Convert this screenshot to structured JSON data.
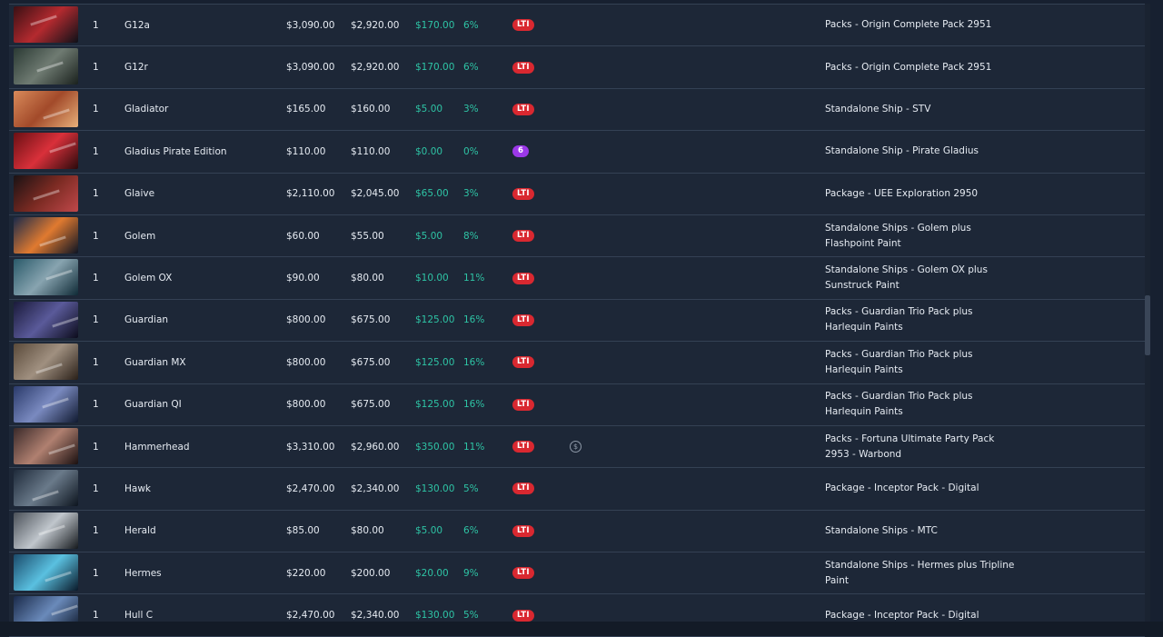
{
  "rows": [
    {
      "qty": "1",
      "name": "G12a",
      "original": "$3,090.00",
      "current": "$2,920.00",
      "savings": "$170.00",
      "percent": "6%",
      "insurance": "LTI",
      "insurance_type": "lti",
      "flag": "",
      "source": "Packs - Origin Complete Pack 2951",
      "thumb": [
        "#3a1014",
        "#b42a2f",
        "#0d1118"
      ]
    },
    {
      "qty": "1",
      "name": "G12r",
      "original": "$3,090.00",
      "current": "$2,920.00",
      "savings": "$170.00",
      "percent": "6%",
      "insurance": "LTI",
      "insurance_type": "lti",
      "flag": "",
      "source": "Packs - Origin Complete Pack 2951",
      "thumb": [
        "#2b3a34",
        "#6f7b72",
        "#1a211d"
      ]
    },
    {
      "qty": "1",
      "name": "Gladiator",
      "original": "$165.00",
      "current": "$160.00",
      "savings": "$5.00",
      "percent": "3%",
      "insurance": "LTI",
      "insurance_type": "lti",
      "flag": "",
      "source": "Standalone Ship - STV",
      "thumb": [
        "#d98a5a",
        "#a24a2a",
        "#e8b07a"
      ]
    },
    {
      "qty": "1",
      "name": "Gladius Pirate Edition",
      "original": "$110.00",
      "current": "$110.00",
      "savings": "$0.00",
      "percent": "0%",
      "insurance": "6",
      "insurance_type": "num",
      "flag": "",
      "source": "Standalone Ship - Pirate Gladius",
      "thumb": [
        "#6a1014",
        "#d9303a",
        "#2a0a0c"
      ]
    },
    {
      "qty": "1",
      "name": "Glaive",
      "original": "$2,110.00",
      "current": "$2,045.00",
      "savings": "$65.00",
      "percent": "3%",
      "insurance": "LTI",
      "insurance_type": "lti",
      "flag": "",
      "source": "Package - UEE Exploration 2950",
      "thumb": [
        "#1a1214",
        "#7a2a22",
        "#c0484a"
      ]
    },
    {
      "qty": "1",
      "name": "Golem",
      "original": "$60.00",
      "current": "$55.00",
      "savings": "$5.00",
      "percent": "8%",
      "insurance": "LTI",
      "insurance_type": "lti",
      "flag": "",
      "source": "Standalone Ships - Golem plus Flashpoint Paint",
      "thumb": [
        "#1a2a4a",
        "#e07a30",
        "#0c1424"
      ]
    },
    {
      "qty": "1",
      "name": "Golem OX",
      "original": "$90.00",
      "current": "$80.00",
      "savings": "$10.00",
      "percent": "11%",
      "insurance": "LTI",
      "insurance_type": "lti",
      "flag": "",
      "source": "Standalone Ships - Golem OX plus Sunstruck Paint",
      "thumb": [
        "#2a5a6a",
        "#88a4b0",
        "#0f2a36"
      ]
    },
    {
      "qty": "1",
      "name": "Guardian",
      "original": "$800.00",
      "current": "$675.00",
      "savings": "$125.00",
      "percent": "16%",
      "insurance": "LTI",
      "insurance_type": "lti",
      "flag": "",
      "source": "Packs - Guardian Trio Pack plus Harlequin Paints",
      "thumb": [
        "#1a1a3a",
        "#5a5a9a",
        "#0c0c1c"
      ]
    },
    {
      "qty": "1",
      "name": "Guardian MX",
      "original": "$800.00",
      "current": "$675.00",
      "savings": "$125.00",
      "percent": "16%",
      "insurance": "LTI",
      "insurance_type": "lti",
      "flag": "",
      "source": "Packs - Guardian Trio Pack plus Harlequin Paints",
      "thumb": [
        "#5a4a3a",
        "#a09080",
        "#2a2018"
      ]
    },
    {
      "qty": "1",
      "name": "Guardian QI",
      "original": "$800.00",
      "current": "$675.00",
      "savings": "$125.00",
      "percent": "16%",
      "insurance": "LTI",
      "insurance_type": "lti",
      "flag": "",
      "source": "Packs - Guardian Trio Pack plus Harlequin Paints",
      "thumb": [
        "#2a3a6a",
        "#7a8ac0",
        "#101a30"
      ]
    },
    {
      "qty": "1",
      "name": "Hammerhead",
      "original": "$3,310.00",
      "current": "$2,960.00",
      "savings": "$350.00",
      "percent": "11%",
      "insurance": "LTI",
      "insurance_type": "lti",
      "flag": "$",
      "source": "Packs - Fortuna Ultimate Party Pack 2953 - Warbond",
      "thumb": [
        "#3a2a2a",
        "#b08070",
        "#1a1010"
      ]
    },
    {
      "qty": "1",
      "name": "Hawk",
      "original": "$2,470.00",
      "current": "$2,340.00",
      "savings": "$130.00",
      "percent": "5%",
      "insurance": "LTI",
      "insurance_type": "lti",
      "flag": "",
      "source": "Package - Inceptor Pack - Digital",
      "thumb": [
        "#1e2a3a",
        "#6a7a8a",
        "#0c141e"
      ]
    },
    {
      "qty": "1",
      "name": "Herald",
      "original": "$85.00",
      "current": "$80.00",
      "savings": "$5.00",
      "percent": "6%",
      "insurance": "LTI",
      "insurance_type": "lti",
      "flag": "",
      "source": "Standalone Ships - MTC",
      "thumb": [
        "#4a5058",
        "#c0c6cc",
        "#14181c"
      ]
    },
    {
      "qty": "1",
      "name": "Hermes",
      "original": "$220.00",
      "current": "$200.00",
      "savings": "$20.00",
      "percent": "9%",
      "insurance": "LTI",
      "insurance_type": "lti",
      "flag": "",
      "source": "Standalone Ships - Hermes plus Tripline Paint",
      "thumb": [
        "#1a4a6a",
        "#5ac0e0",
        "#0a1a2a"
      ]
    },
    {
      "qty": "1",
      "name": "Hull C",
      "original": "$2,470.00",
      "current": "$2,340.00",
      "savings": "$130.00",
      "percent": "5%",
      "insurance": "LTI",
      "insurance_type": "lti",
      "flag": "",
      "source": "Package - Inceptor Pack - Digital",
      "thumb": [
        "#1a2a4a",
        "#6a8aba",
        "#0a1426"
      ]
    }
  ]
}
